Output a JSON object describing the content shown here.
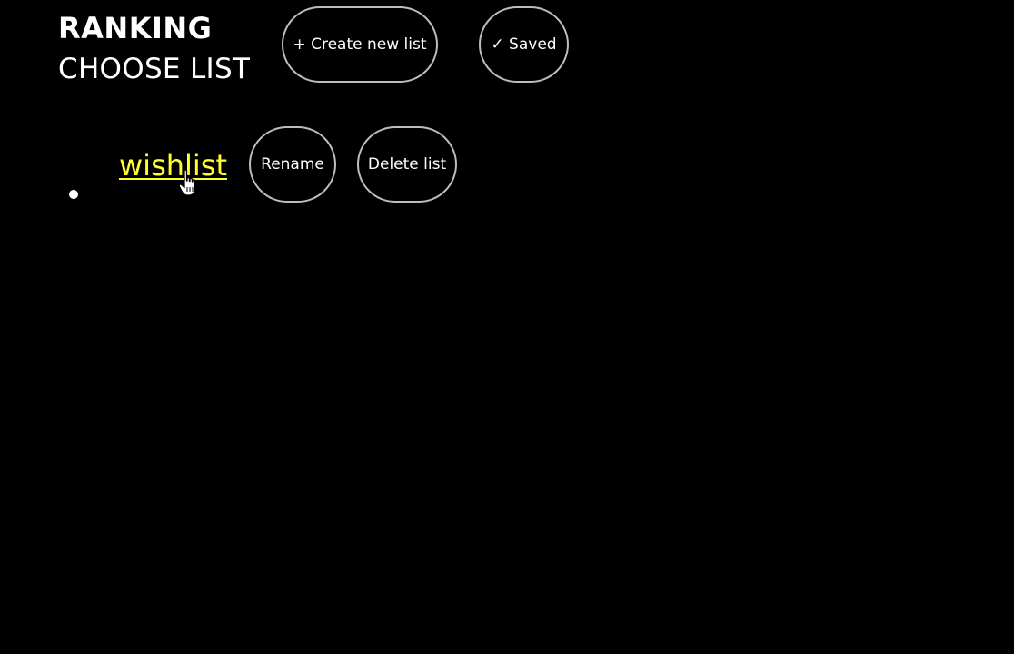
{
  "header": {
    "title": "RANKING",
    "subtitle": "CHOOSE LIST"
  },
  "toolbar": {
    "create_label": "+ Create new list",
    "saved_label": "✓ Saved"
  },
  "lists": [
    {
      "name": "wishlist",
      "rename_label": "Rename",
      "delete_label": "Delete list"
    }
  ],
  "colors": {
    "background": "#000000",
    "text": "#ffffff",
    "link": "#ffff33",
    "button_border": "#bdbdbd"
  },
  "icons": {
    "cursor": "hand-pointer-icon"
  }
}
